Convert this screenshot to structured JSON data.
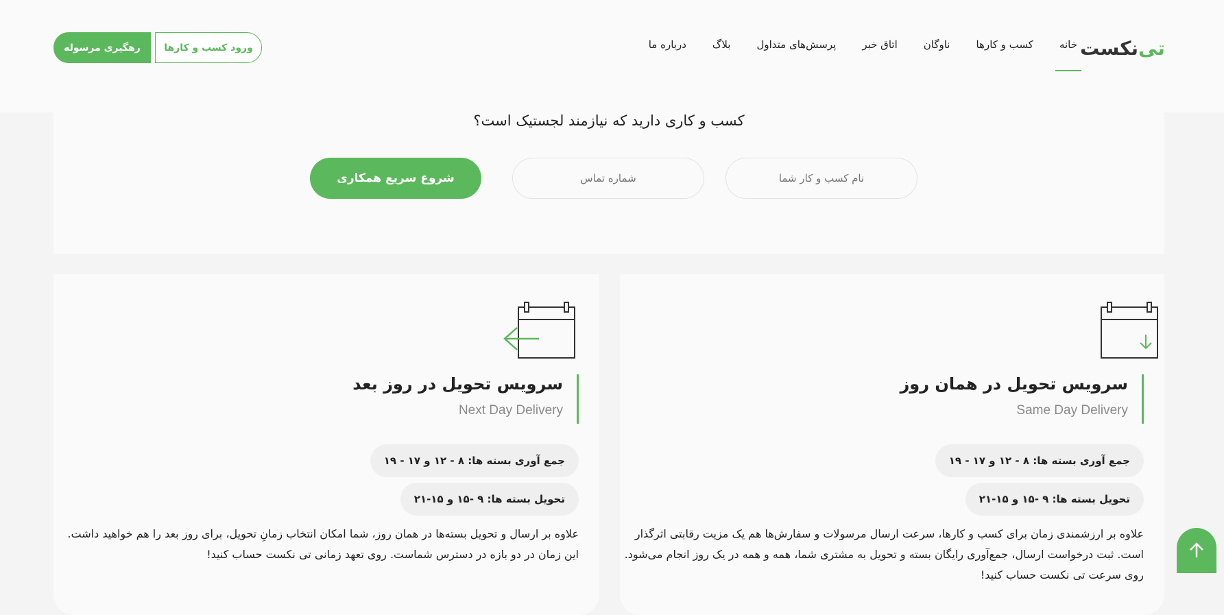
{
  "header": {
    "logo_mark": "تی",
    "logo_text": "نکست",
    "nav": [
      {
        "label": "خانه",
        "active": true
      },
      {
        "label": "کسب و کارها",
        "active": false
      },
      {
        "label": "ناوگان",
        "active": false
      },
      {
        "label": "اتاق خبر",
        "active": false
      },
      {
        "label": "پرسش‌های متداول",
        "active": false
      },
      {
        "label": "بلاگ",
        "active": false
      },
      {
        "label": "درباره ما",
        "active": false
      }
    ],
    "login_label": "ورود کسب و کارها",
    "track_label": "رهگیری مرسوله"
  },
  "lead": {
    "question": "کسب و کاری دارید که نیازمند لجستیک است؟",
    "name_placeholder": "نام کسب و کار شما",
    "phone_placeholder": "شماره تماس",
    "start_label": "شروع سریع همکاری"
  },
  "services": {
    "same_day": {
      "icon": "calendar-down-arrow-icon",
      "title": "سرویس تحویل در همان روز",
      "subtitle": "Same Day Delivery",
      "collect": "جمع آوری بسته ها: ۸ - ۱۲ و ۱۷ - ۱۹",
      "deliver": "تحویل بسته ها: ۹ -۱۵ و ۱۵-۲۱",
      "description": "علاوه بر ارزشمندی زمان برای کسب و کارها، سرعت ارسال مرسولات و سفارش‌ها هم یک مزیت رقابتی اثرگذار است. ثبت درخواست ارسال، جمع‌آوری رایگان بسته و تحویل به مشتری شما، همه و همه در یک روز انجام می‌شود. روی سرعت تی نکست حساب کنید!"
    },
    "next_day": {
      "icon": "calendar-left-arrow-icon",
      "title": "سرویس تحویل در روز بعد",
      "subtitle": "Next Day Delivery",
      "collect": "جمع آوری بسته ها: ۸ - ۱۲ و ۱۷ - ۱۹",
      "deliver": "تحویل بسته ها: ۹ -۱۵ و ۱۵-۲۱",
      "description": "علاوه بر ارسال و تحویل بسته‌ها در همان روز، شما امکان انتخاب زمانِ تحویل، برای روز بعد را هم خواهید داشت. این زمان در دو بازه در دسترس شماست. روی تعهد زمانی تی نکست حساب کنید!"
    }
  },
  "colors": {
    "brand_green": "#5cb85c",
    "text": "#222222",
    "muted": "#8a8a8a",
    "page_bg": "#f4f4f4"
  },
  "scroll_top_icon": "arrow-up-icon"
}
